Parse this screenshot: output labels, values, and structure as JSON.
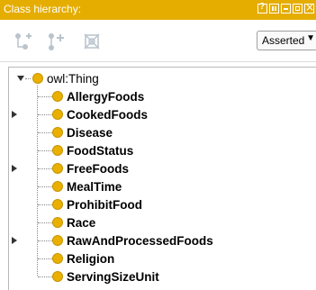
{
  "window": {
    "title": "Class hierarchy:"
  },
  "toolbar": {
    "view_mode": "Asserted",
    "buttons": [
      {
        "name": "add-subclass-icon"
      },
      {
        "name": "add-sibling-icon"
      },
      {
        "name": "delete-class-icon"
      }
    ]
  },
  "tree": {
    "root": {
      "label": "owl:Thing",
      "expanded": true
    },
    "children": [
      {
        "label": "AllergyFoods",
        "has_children": false
      },
      {
        "label": "CookedFoods",
        "has_children": true
      },
      {
        "label": "Disease",
        "has_children": false
      },
      {
        "label": "FoodStatus",
        "has_children": false
      },
      {
        "label": "FreeFoods",
        "has_children": true
      },
      {
        "label": "MealTime",
        "has_children": false
      },
      {
        "label": "ProhibitFood",
        "has_children": false
      },
      {
        "label": "Race",
        "has_children": false
      },
      {
        "label": "RawAndProcessedFoods",
        "has_children": true
      },
      {
        "label": "Religion",
        "has_children": false
      },
      {
        "label": "ServingSizeUnit",
        "has_children": false
      }
    ]
  },
  "colors": {
    "titlebar": "#e5ad00",
    "class_bullet": "#e9b000"
  }
}
